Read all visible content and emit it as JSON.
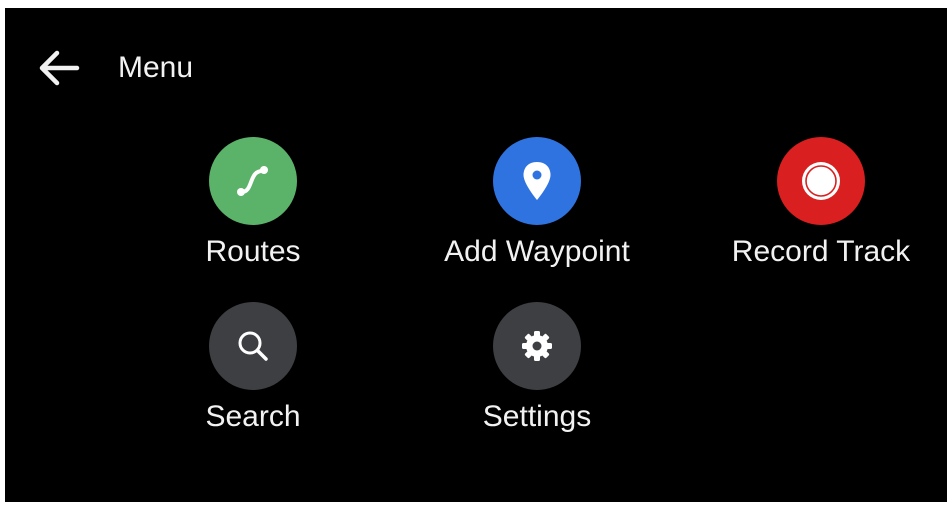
{
  "header": {
    "back_icon": "arrow-left-icon",
    "title": "Menu"
  },
  "colors": {
    "background": "#000000",
    "text": "#f2f2f2",
    "routes": "#5bb36a",
    "waypoint": "#2f73e0",
    "record": "#d91f1f",
    "neutral": "#3d3f42"
  },
  "menu": {
    "items": [
      {
        "label": "Routes",
        "icon": "route-icon"
      },
      {
        "label": "Add Waypoint",
        "icon": "map-pin-icon"
      },
      {
        "label": "Record Track",
        "icon": "record-icon"
      },
      {
        "label": "Search",
        "icon": "search-icon"
      },
      {
        "label": "Settings",
        "icon": "gear-icon"
      }
    ]
  }
}
